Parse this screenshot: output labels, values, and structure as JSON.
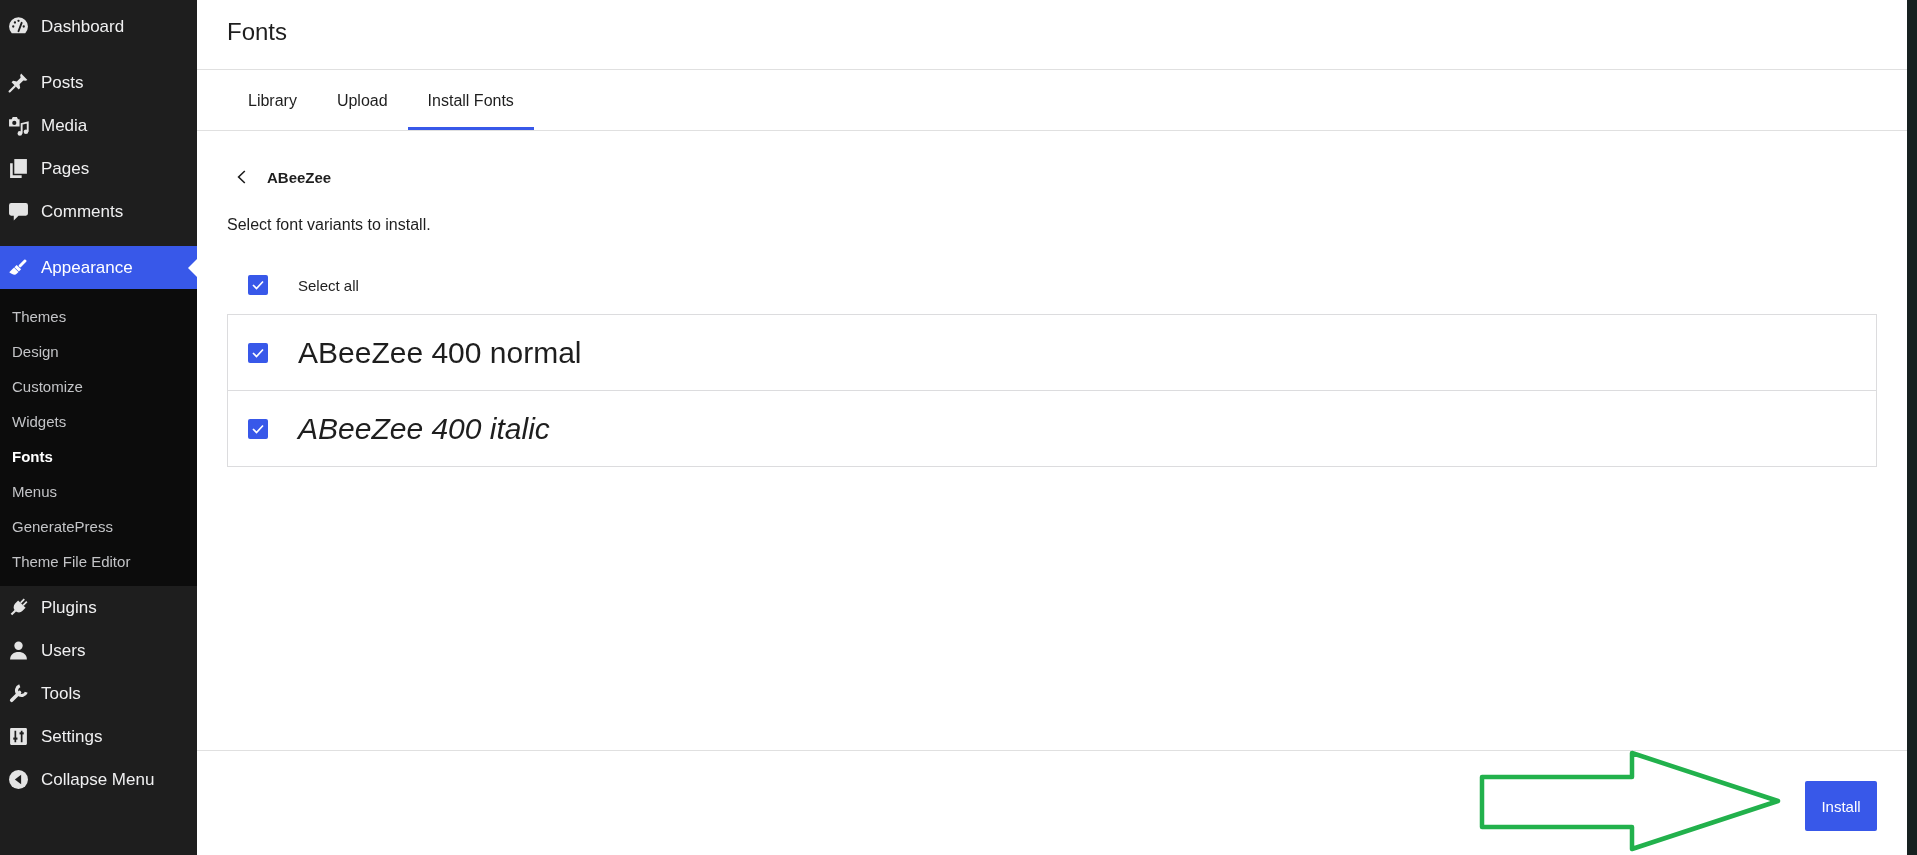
{
  "sidebar": {
    "items": [
      {
        "label": "Dashboard",
        "selected": false
      },
      {
        "label": "Posts",
        "selected": false
      },
      {
        "label": "Media",
        "selected": false
      },
      {
        "label": "Pages",
        "selected": false
      },
      {
        "label": "Comments",
        "selected": false
      },
      {
        "label": "Appearance",
        "selected": true,
        "children": [
          {
            "label": "Themes",
            "selected": false
          },
          {
            "label": "Design",
            "selected": false
          },
          {
            "label": "Customize",
            "selected": false
          },
          {
            "label": "Widgets",
            "selected": false
          },
          {
            "label": "Fonts",
            "selected": true
          },
          {
            "label": "Menus",
            "selected": false
          },
          {
            "label": "GeneratePress",
            "selected": false
          },
          {
            "label": "Theme File Editor",
            "selected": false
          }
        ]
      },
      {
        "label": "Plugins",
        "selected": false
      },
      {
        "label": "Users",
        "selected": false
      },
      {
        "label": "Tools",
        "selected": false
      },
      {
        "label": "Settings",
        "selected": false
      }
    ],
    "collapse_button": {
      "label": "Collapse Menu"
    }
  },
  "header": {
    "title": "Fonts"
  },
  "tabs": [
    {
      "label": "Library",
      "selected": false
    },
    {
      "label": "Upload",
      "selected": false
    },
    {
      "label": "Install Fonts",
      "selected": true
    }
  ],
  "font_panel": {
    "heading": "ABeeZee",
    "description": "Select font variants to install.",
    "select_all": {
      "label": "Select all",
      "checked": true
    },
    "variants": [
      {
        "label": "ABeeZee 400 normal",
        "kind": "normal",
        "checked": true
      },
      {
        "label": "ABeeZee 400 italic",
        "kind": "italic",
        "checked": true
      }
    ]
  },
  "footer": {
    "install_button": {
      "label": "Install"
    }
  }
}
